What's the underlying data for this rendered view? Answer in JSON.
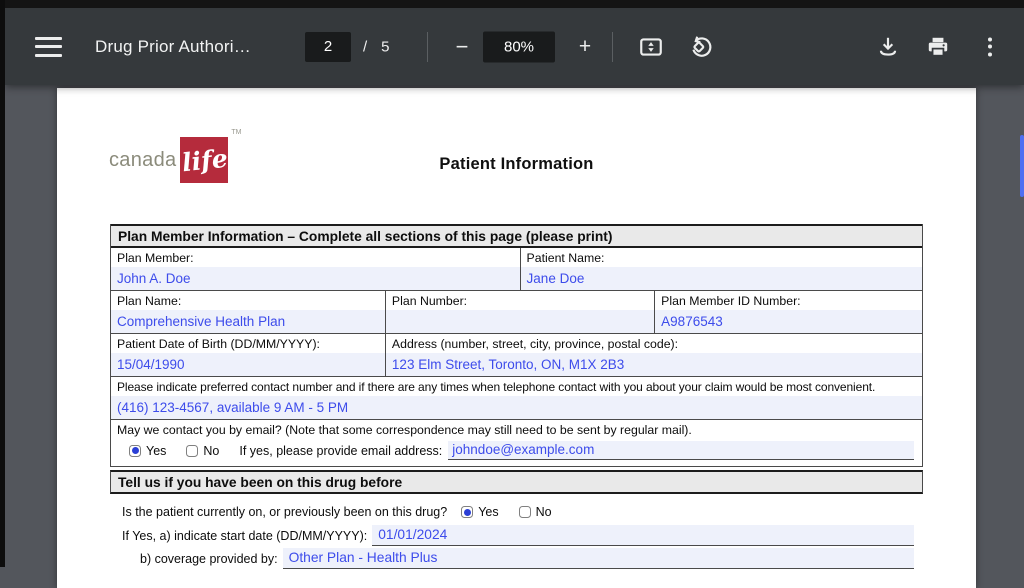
{
  "toolbar": {
    "title": "Drug Prior Authori…",
    "page_current": "2",
    "page_divider": "/",
    "page_total": "5",
    "zoom_out_glyph": "−",
    "zoom_level": "80%",
    "zoom_in_glyph": "+"
  },
  "logo": {
    "canada": "canada",
    "life": "life",
    "tm": "TM"
  },
  "doc": {
    "title": "Patient Information",
    "section1": {
      "header": "Plan Member Information – Complete all sections of this page (please print)",
      "row1": {
        "c1": {
          "label": "Plan Member:",
          "value": "John A. Doe"
        },
        "c2": {
          "label": "Patient Name:",
          "value": "Jane Doe"
        }
      },
      "row2": {
        "c1": {
          "label": "Plan Name:",
          "value": "Comprehensive Health Plan"
        },
        "c2": {
          "label": "Plan Number:",
          "value": ""
        },
        "c3": {
          "label": "Plan Member ID Number:",
          "value": "A9876543"
        }
      },
      "row3": {
        "c1": {
          "label": "Patient Date of Birth (DD/MM/YYYY):",
          "value": "15/04/1990"
        },
        "c2": {
          "label": "Address (number, street, city, province, postal code):",
          "value": "123 Elm Street, Toronto, ON, M1X 2B3"
        }
      },
      "row4": {
        "label": "Please indicate preferred contact number and if there are any times when telephone contact with you about your claim would be most convenient.",
        "value": "(416) 123-4567, available 9 AM - 5 PM"
      },
      "row5": {
        "label": "May we contact you by email? (Note that some correspondence may still need to be sent by regular mail).",
        "yes": "Yes",
        "no": "No",
        "email_prompt": "If yes, please provide email address:",
        "email_value": "johndoe@example.com"
      }
    },
    "section2": {
      "header": "Tell us if you have been on this drug before",
      "q1": {
        "label": "Is the patient currently on, or previously been on this drug?",
        "yes": "Yes",
        "no": "No"
      },
      "q2": {
        "label": "If Yes, a) indicate start date (DD/MM/YYYY):",
        "value": "01/01/2024"
      },
      "q3": {
        "label": "b) coverage provided by:",
        "value": "Other Plan - Health Plus"
      }
    }
  },
  "colors": {
    "toolbar_bg": "#35393c",
    "viewer_bg": "#53565c",
    "page_bg": "#ffffff",
    "field_bg": "#eef1fb",
    "form_value_blue": "#3d4ceb",
    "brand_red": "#b52b3c",
    "section_header_bg": "#e9e9e9",
    "scrollbar_blue": "#4e6ef2",
    "checkbox_dot_blue": "#2b3fd6"
  }
}
